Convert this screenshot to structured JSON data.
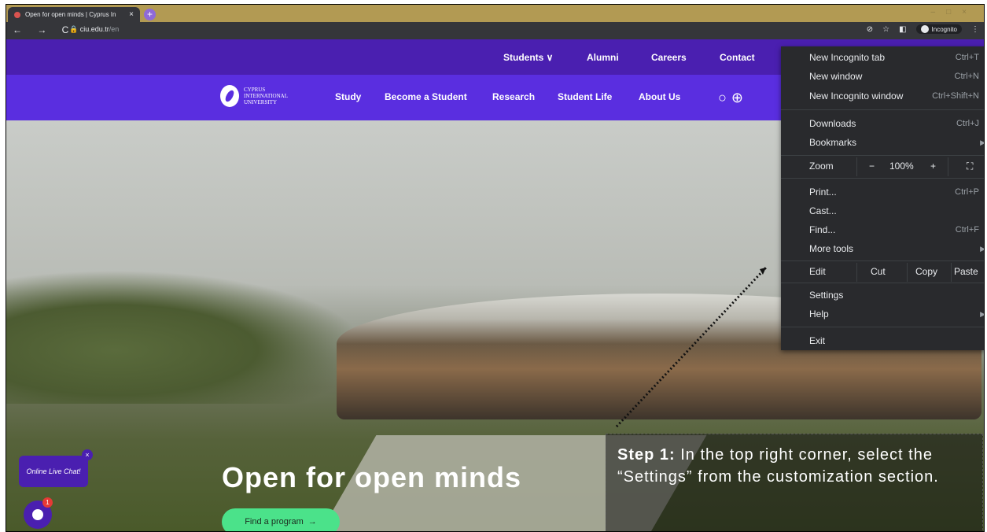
{
  "tab": {
    "title": "Open for open minds | Cyprus In",
    "close": "×",
    "new_tab": "+"
  },
  "toolbar": {
    "nav": "← → C",
    "url_host": "ciu.edu.tr",
    "url_path": "/en",
    "incognito_label": "Incognito",
    "menu_icon": "⋮"
  },
  "site": {
    "topnav": [
      "Students ∨",
      "Alumni",
      "Careers",
      "Contact"
    ],
    "logo_lines": [
      "CYPRUS",
      "INTERNATIONAL",
      "UNIVERSITY"
    ],
    "mainnav": [
      "Study",
      "Become a Student",
      "Research",
      "Student Life",
      "About Us"
    ],
    "headline": "Open for open minds",
    "cta": "Find a program",
    "chat_label": "Online Live Chat!",
    "chat_badge": "1"
  },
  "menu": {
    "new_incognito_tab": {
      "label": "New Incognito tab",
      "key": "Ctrl+T"
    },
    "new_window": {
      "label": "New window",
      "key": "Ctrl+N"
    },
    "new_incognito_window": {
      "label": "New Incognito window",
      "key": "Ctrl+Shift+N"
    },
    "downloads": {
      "label": "Downloads",
      "key": "Ctrl+J"
    },
    "bookmarks": {
      "label": "Bookmarks"
    },
    "zoom": {
      "label": "Zoom",
      "minus": "−",
      "value": "100%",
      "plus": "+"
    },
    "print": {
      "label": "Print...",
      "key": "Ctrl+P"
    },
    "cast": {
      "label": "Cast..."
    },
    "find": {
      "label": "Find...",
      "key": "Ctrl+F"
    },
    "more_tools": {
      "label": "More tools"
    },
    "edit": {
      "label": "Edit",
      "cut": "Cut",
      "copy": "Copy",
      "paste": "Paste"
    },
    "settings": {
      "label": "Settings"
    },
    "help": {
      "label": "Help"
    },
    "exit": {
      "label": "Exit"
    }
  },
  "annotation": {
    "step": "Step 1:",
    "text": " In the top right corner, select the “Settings” from the customization section."
  }
}
